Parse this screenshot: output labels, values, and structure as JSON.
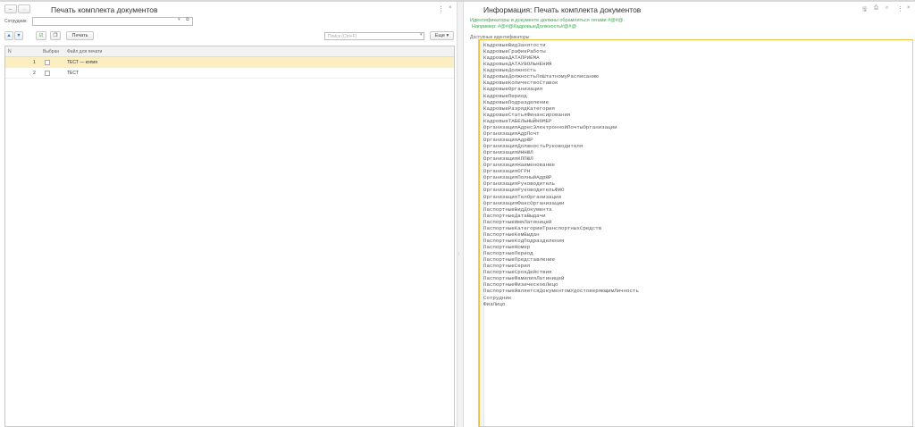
{
  "left": {
    "title": "Печать комплекта документов",
    "employee_label": "Сотрудник:",
    "employee_value": "",
    "print_button": "Печать",
    "search_placeholder": "Поиск (Ctrl+F)",
    "more_button": "Еще",
    "columns": [
      "N",
      "Выбран",
      "Файл для печати"
    ],
    "rows": [
      {
        "n": "1",
        "checked": false,
        "file": "ТЕСТ — копия"
      },
      {
        "n": "2",
        "checked": false,
        "file": "ТЕСТ"
      }
    ]
  },
  "right": {
    "title": "Информация: Печать комплекта документов",
    "hint1": "Идентификаторы в документе должны обрамляться тегами #@#@.",
    "hint2": "Например: #@#@КадровыеДолжность#@#@",
    "ids_label": "Доступные идентификаторы:",
    "identifiers": [
      "КадровыеВидЗанятости",
      "КадровыеГрафикРаботы",
      "КадровыеДАТАПРИЕМА",
      "КадровыеДАТАУВОЛЬНЕНИЯ",
      "КадровыеДолжность",
      "КадровыеДолжностьПоШтатномуРасписанию",
      "КадровыеКоличествоСтавок",
      "КадровыеОрганизация",
      "КадровыеПериод",
      "КадровыеПодразделение",
      "КадровыеРазрядКатегория",
      "КадровыеСтатьяФинансирования",
      "КадровыеТАБЕЛЬНЫЙНОМЕР",
      "ОрганизацияАдресЭлектроннойПочтыОрганизации",
      "ОрганизацияАдрПочт",
      "ОрганизацияАдрЮР",
      "ОрганизацияДолжностьРуководителя",
      "ОрганизацияИННЮЛ",
      "ОрганизацияКППЮЛ",
      "ОрганизацияНаименование",
      "ОрганизацияОГРН",
      "ОрганизацияПолныйАдрЮР",
      "ОрганизацияРуководитель",
      "ОрганизацияРуководительФИО",
      "ОрганизацияТелОрганизации",
      "ОрганизацияФаксОрганизации",
      "ПаспортныеВидДокумента",
      "ПаспортныеДатаВыдачи",
      "ПаспортныеИмяЛатиницей",
      "ПаспортныеКатегорииТранспортныхСредств",
      "ПаспортныеКемВыдан",
      "ПаспортныеКодПодразделения",
      "ПаспортныеНомер",
      "ПаспортныеПериод",
      "ПаспортныеПредставление",
      "ПаспортныеСерия",
      "ПаспортныеСрокДействия",
      "ПаспортныеФамилияЛатиницей",
      "ПаспортныеФизическоеЛицо",
      "ПаспортныеЯвляетсяДокументомУдостоверяющимЛичность",
      "Сотрудник",
      "ФизЛицо"
    ]
  }
}
